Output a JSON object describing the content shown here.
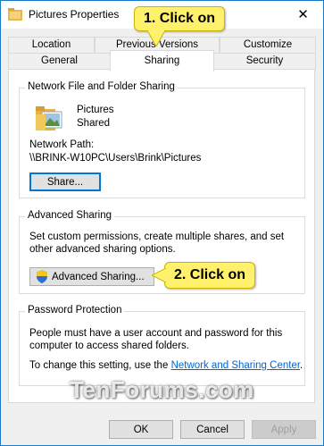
{
  "window": {
    "title": "Pictures Properties",
    "close_glyph": "✕"
  },
  "tabs": {
    "row1": [
      {
        "label": "Location"
      },
      {
        "label": "Previous Versions"
      },
      {
        "label": "Customize"
      }
    ],
    "row2": [
      {
        "label": "General"
      },
      {
        "label": "Sharing"
      },
      {
        "label": "Security"
      }
    ],
    "active": "Sharing"
  },
  "network_sharing": {
    "title": "Network File and Folder Sharing",
    "folder_name": "Pictures",
    "status": "Shared",
    "path_label": "Network Path:",
    "path": "\\\\BRINK-W10PC\\Users\\Brink\\Pictures",
    "share_button": "Share..."
  },
  "advanced_sharing": {
    "title": "Advanced Sharing",
    "description": "Set custom permissions, create multiple shares, and set other advanced sharing options.",
    "button": "Advanced Sharing..."
  },
  "password_protection": {
    "title": "Password Protection",
    "description": "People must have a user account and password for this computer to access shared folders.",
    "change_text": "To change this setting, use the",
    "link": "Network and Sharing Center",
    "link_suffix": "."
  },
  "footer": {
    "ok": "OK",
    "cancel": "Cancel",
    "apply": "Apply"
  },
  "callouts": {
    "step1": "1. Click on",
    "step2": "2. Click on"
  },
  "watermark": "TenForums.com",
  "colors": {
    "accent": "#0078d7",
    "link": "#0066cc",
    "callout_bg": "#fff16b",
    "window_border": "#1979ca"
  }
}
